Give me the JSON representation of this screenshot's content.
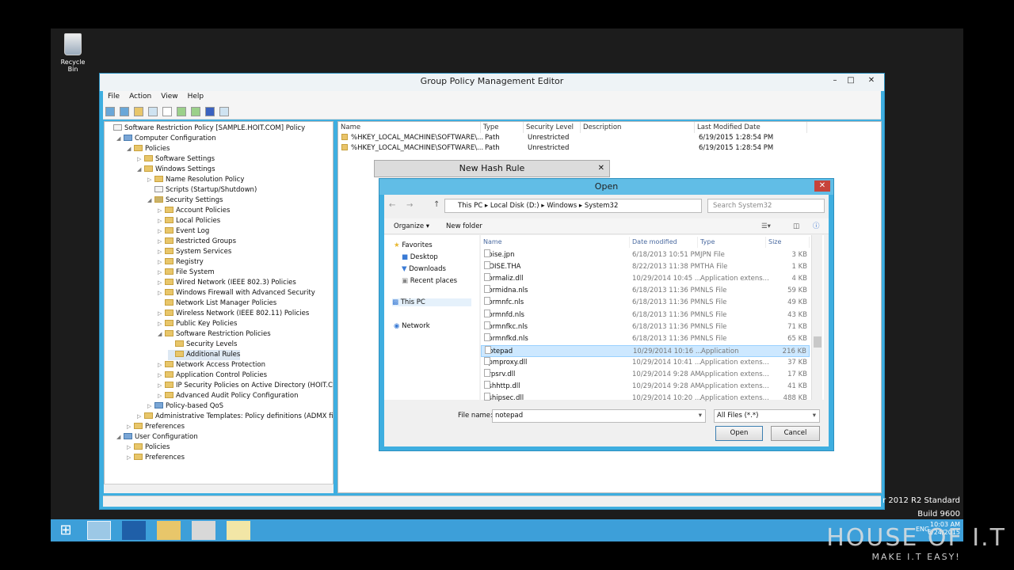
{
  "desktop": {
    "recycle_bin_label": "Recycle Bin"
  },
  "window": {
    "title": "Group Policy Management Editor",
    "min": "–",
    "max": "□",
    "close": "✕"
  },
  "menu": [
    "File",
    "Action",
    "View",
    "Help"
  ],
  "tree": [
    {
      "label": "Software Restriction Policy [SAMPLE.HOIT.COM] Policy",
      "indent": 0,
      "arrow": "",
      "icon": "policy"
    },
    {
      "label": "Computer Configuration",
      "indent": 1,
      "arrow": "◢",
      "icon": "computer"
    },
    {
      "label": "Policies",
      "indent": 2,
      "arrow": "◢",
      "icon": "folder"
    },
    {
      "label": "Software Settings",
      "indent": 3,
      "arrow": "▷",
      "icon": "folder"
    },
    {
      "label": "Windows Settings",
      "indent": 3,
      "arrow": "◢",
      "icon": "folder"
    },
    {
      "label": "Name Resolution Policy",
      "indent": 4,
      "arrow": "▷",
      "icon": "folder"
    },
    {
      "label": "Scripts (Startup/Shutdown)",
      "indent": 4,
      "arrow": "",
      "icon": "doc"
    },
    {
      "label": "Security Settings",
      "indent": 4,
      "arrow": "◢",
      "icon": "shield"
    },
    {
      "label": "Account Policies",
      "indent": 5,
      "arrow": "▷",
      "icon": "folder"
    },
    {
      "label": "Local Policies",
      "indent": 5,
      "arrow": "▷",
      "icon": "folder"
    },
    {
      "label": "Event Log",
      "indent": 5,
      "arrow": "▷",
      "icon": "folder"
    },
    {
      "label": "Restricted Groups",
      "indent": 5,
      "arrow": "▷",
      "icon": "folder"
    },
    {
      "label": "System Services",
      "indent": 5,
      "arrow": "▷",
      "icon": "folder"
    },
    {
      "label": "Registry",
      "indent": 5,
      "arrow": "▷",
      "icon": "folder"
    },
    {
      "label": "File System",
      "indent": 5,
      "arrow": "▷",
      "icon": "folder"
    },
    {
      "label": "Wired Network (IEEE 802.3) Policies",
      "indent": 5,
      "arrow": "▷",
      "icon": "folder"
    },
    {
      "label": "Windows Firewall with Advanced Security",
      "indent": 5,
      "arrow": "▷",
      "icon": "folder"
    },
    {
      "label": "Network List Manager Policies",
      "indent": 5,
      "arrow": "",
      "icon": "folder"
    },
    {
      "label": "Wireless Network (IEEE 802.11) Policies",
      "indent": 5,
      "arrow": "▷",
      "icon": "folder"
    },
    {
      "label": "Public Key Policies",
      "indent": 5,
      "arrow": "▷",
      "icon": "folder"
    },
    {
      "label": "Software Restriction Policies",
      "indent": 5,
      "arrow": "◢",
      "icon": "folder"
    },
    {
      "label": "Security Levels",
      "indent": 6,
      "arrow": "",
      "icon": "folder"
    },
    {
      "label": "Additional Rules",
      "indent": 6,
      "arrow": "",
      "icon": "folder",
      "selected": true
    },
    {
      "label": "Network Access Protection",
      "indent": 5,
      "arrow": "▷",
      "icon": "folder"
    },
    {
      "label": "Application Control Policies",
      "indent": 5,
      "arrow": "▷",
      "icon": "folder"
    },
    {
      "label": "IP Security Policies on Active Directory (HOIT.COM)",
      "indent": 5,
      "arrow": "▷",
      "icon": "folder"
    },
    {
      "label": "Advanced Audit Policy Configuration",
      "indent": 5,
      "arrow": "▷",
      "icon": "folder"
    },
    {
      "label": "Policy-based QoS",
      "indent": 4,
      "arrow": "▷",
      "icon": "chart"
    },
    {
      "label": "Administrative Templates: Policy definitions (ADMX files) retr",
      "indent": 3,
      "arrow": "▷",
      "icon": "folder"
    },
    {
      "label": "Preferences",
      "indent": 2,
      "arrow": "▷",
      "icon": "folder"
    },
    {
      "label": "User Configuration",
      "indent": 1,
      "arrow": "◢",
      "icon": "user"
    },
    {
      "label": "Policies",
      "indent": 2,
      "arrow": "▷",
      "icon": "folder"
    },
    {
      "label": "Preferences",
      "indent": 2,
      "arrow": "▷",
      "icon": "folder"
    }
  ],
  "list": {
    "columns": [
      "Name",
      "Type",
      "Security Level",
      "Description",
      "Last Modified Date"
    ],
    "rows": [
      [
        "%HKEY_LOCAL_MACHINE\\SOFTWARE\\...",
        "Path",
        "Unrestricted",
        "",
        "6/19/2015 1:28:54 PM"
      ],
      [
        "%HKEY_LOCAL_MACHINE\\SOFTWARE\\...",
        "Path",
        "Unrestricted",
        "",
        "6/19/2015 1:28:54 PM"
      ]
    ]
  },
  "hash_dialog": {
    "title": "New Hash Rule",
    "close": "✕"
  },
  "open_dialog": {
    "title": "Open",
    "close": "✕",
    "address": [
      "This PC",
      "Local Disk (D:)",
      "Windows",
      "System32"
    ],
    "search_placeholder": "Search System32",
    "organize": "Organize ▾",
    "new_folder": "New folder",
    "nav": [
      "Favorites",
      "Desktop",
      "Downloads",
      "Recent places",
      "This PC",
      "Network"
    ],
    "columns": [
      "Name",
      "Date modified",
      "Type",
      "Size"
    ],
    "files": [
      [
        "noise.jpn",
        "6/18/2013 10:51 PM",
        "JPN File",
        "3 KB"
      ],
      [
        "NOISE.THA",
        "8/22/2013 11:38 PM",
        "THA File",
        "1 KB"
      ],
      [
        "normaliz.dll",
        "10/29/2014 10:45 ...",
        "Application extens...",
        "4 KB"
      ],
      [
        "normidna.nls",
        "6/18/2013 11:36 PM",
        "NLS File",
        "59 KB"
      ],
      [
        "normnfc.nls",
        "6/18/2013 11:36 PM",
        "NLS File",
        "49 KB"
      ],
      [
        "normnfd.nls",
        "6/18/2013 11:36 PM",
        "NLS File",
        "43 KB"
      ],
      [
        "normnfkc.nls",
        "6/18/2013 11:36 PM",
        "NLS File",
        "71 KB"
      ],
      [
        "normnfkd.nls",
        "6/18/2013 11:36 PM",
        "NLS File",
        "65 KB"
      ],
      [
        "notepad",
        "10/29/2014 10:16 ...",
        "Application",
        "216 KB"
      ],
      [
        "npmproxy.dll",
        "10/29/2014 10:41 ...",
        "Application extens...",
        "37 KB"
      ],
      [
        "nrpsrv.dll",
        "10/29/2014 9:28 AM",
        "Application extens...",
        "17 KB"
      ],
      [
        "nshhttp.dll",
        "10/29/2014 9:28 AM",
        "Application extens...",
        "41 KB"
      ],
      [
        "nshipsec.dll",
        "10/29/2014 10:20 ...",
        "Application extens...",
        "488 KB"
      ]
    ],
    "selected_index": 8,
    "file_name_label": "File name:",
    "file_name_value": "notepad",
    "filter_value": "All Files (*.*)",
    "open_label": "Open",
    "cancel_label": "Cancel"
  },
  "os": {
    "line1": "r 2012 R2 Standard",
    "line2": "Build 9600",
    "time": "10:03 AM",
    "date": "6/24/2015",
    "lang": "ENG"
  },
  "watermark": {
    "title": "HOUSE OF I.T",
    "tagline": "MAKE I.T EASY!"
  },
  "colors": {
    "accent": "#3eaee0",
    "taskbar": "#3d9fd9",
    "selection": "#cde8ff",
    "close_red": "#c7433a"
  }
}
